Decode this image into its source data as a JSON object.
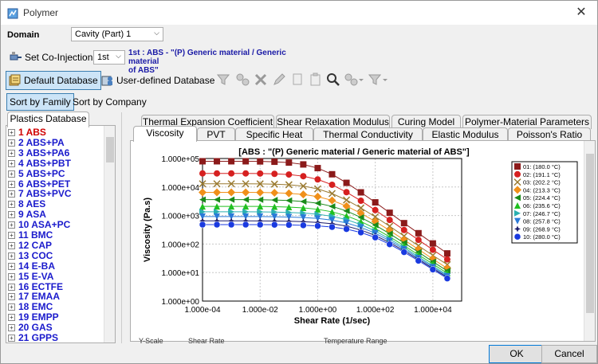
{
  "window": {
    "title": "Polymer",
    "close_label": "✕"
  },
  "domain": {
    "label": "Domain",
    "value": "Cavity (Part) 1"
  },
  "coinjection": {
    "label": "Set Co-Injection",
    "value": "1st",
    "info_line1": "1st : ABS - \"(P)  Generic material / Generic material",
    "info_line2": "of ABS\""
  },
  "toolbar": {
    "default_db": "Default Database",
    "user_db": "User-defined Database"
  },
  "sort": {
    "by_family": "Sort by Family",
    "by_company": "Sort by Company"
  },
  "left_tab": "Plastics Database",
  "materials": [
    "1  ABS",
    "2  ABS+PA",
    "3  ABS+PA6",
    "4  ABS+PBT",
    "5  ABS+PC",
    "6  ABS+PET",
    "7  ABS+PVC",
    "8  AES",
    "9  ASA",
    "10  ASA+PC",
    "11  BMC",
    "12  CAP",
    "13  COC",
    "14  E-BA",
    "15  E-VA",
    "16  ECTFE",
    "17  EMAA",
    "18  EMC",
    "19  EMPP",
    "20  GAS",
    "21  GPPS"
  ],
  "tabs_row1": [
    "Thermal Expansion Coefficient",
    "Shear Relaxation Modulus",
    "Curing Model",
    "Polymer-Material Parameters"
  ],
  "tabs_row2": [
    "Viscosity",
    "PVT",
    "Specific Heat",
    "Thermal Conductivity",
    "Elastic Modulus",
    "Poisson's Ratio"
  ],
  "bottom_partial": {
    "a": "Y-Scale",
    "b": "Shear Rate",
    "c": "Temperature Range"
  },
  "buttons": {
    "ok": "OK",
    "cancel": "Cancel"
  },
  "colors": {
    "selected_item": "#d00000",
    "item": "#1a1acc",
    "accent": "#0078d7"
  },
  "chart_data": {
    "type": "line",
    "title": "[ABS : \"(P)  Generic material / Generic material of ABS\"]",
    "xlabel": "Shear Rate (1/sec)",
    "ylabel": "Viscosity (Pa.s)",
    "x_scale": "log",
    "y_scale": "log",
    "xlim": [
      0.0001,
      100000
    ],
    "ylim": [
      1,
      100000
    ],
    "xticks": [
      "1.000e-04",
      "1.000e-02",
      "1.000e+00",
      "1.000e+02",
      "1.000e+04"
    ],
    "yticks": [
      "1.000e+00",
      "1.000e+01",
      "1.000e+02",
      "1.000e+03",
      "1.000e+04",
      "1.000e+05"
    ],
    "grid": true,
    "legend_position": "right",
    "x": [
      0.0001,
      0.000316,
      0.001,
      0.00316,
      0.01,
      0.0316,
      0.1,
      0.316,
      1,
      3.16,
      10,
      31.6,
      100,
      316,
      1000,
      3160,
      10000,
      31600
    ],
    "series": [
      {
        "name": "01: (180.0  °C)",
        "color": "#8b1a1a",
        "marker": "square",
        "values": [
          80000,
          80000,
          80000,
          80000,
          79000,
          77000,
          72000,
          62000,
          46000,
          28000,
          14000,
          6500,
          2900,
          1250,
          540,
          240,
          105,
          47
        ]
      },
      {
        "name": "02: (191.1  °C)",
        "color": "#d62020",
        "marker": "circle",
        "values": [
          30000,
          30000,
          30000,
          30000,
          29800,
          29000,
          27500,
          24000,
          18500,
          12000,
          6600,
          3300,
          1550,
          700,
          310,
          140,
          63,
          29
        ]
      },
      {
        "name": "03: (202.2  °C)",
        "color": "#9a7a30",
        "marker": "x",
        "values": [
          13000,
          13000,
          13000,
          13000,
          12900,
          12600,
          12000,
          10800,
          8600,
          5900,
          3500,
          1850,
          900,
          420,
          190,
          87,
          40,
          19
        ]
      },
      {
        "name": "04: (213.3  °C)",
        "color": "#f0901a",
        "marker": "diamond",
        "values": [
          6500,
          6500,
          6500,
          6500,
          6450,
          6300,
          6000,
          5500,
          4600,
          3400,
          2150,
          1200,
          620,
          300,
          140,
          65,
          30,
          14
        ]
      },
      {
        "name": "05: (224.4  °C)",
        "color": "#1a8a1a",
        "marker": "triangle-left",
        "values": [
          3600,
          3600,
          3600,
          3600,
          3580,
          3500,
          3350,
          3100,
          2700,
          2100,
          1450,
          860,
          460,
          230,
          110,
          52,
          24,
          11.5
        ]
      },
      {
        "name": "06: (235.6  °C)",
        "color": "#20c020",
        "marker": "triangle-up",
        "values": [
          2100,
          2100,
          2100,
          2100,
          2090,
          2050,
          1980,
          1860,
          1650,
          1350,
          980,
          620,
          350,
          180,
          88,
          42,
          20,
          9.5
        ]
      },
      {
        "name": "07: (246.7  °C)",
        "color": "#2ab0b0",
        "marker": "triangle-right",
        "values": [
          1350,
          1350,
          1350,
          1350,
          1345,
          1320,
          1280,
          1220,
          1110,
          940,
          720,
          480,
          285,
          150,
          75,
          36,
          17,
          8.2
        ]
      },
      {
        "name": "08: (257.8  °C)",
        "color": "#2a7ad8",
        "marker": "triangle-down",
        "values": [
          920,
          920,
          920,
          920,
          918,
          905,
          885,
          850,
          790,
          690,
          550,
          385,
          240,
          130,
          66,
          32,
          15.5,
          7.4
        ]
      },
      {
        "name": "09: (268.9  °C)",
        "color": "#1a1a6a",
        "marker": "star",
        "values": [
          650,
          650,
          650,
          650,
          649,
          642,
          630,
          610,
          575,
          515,
          425,
          310,
          200,
          112,
          58,
          29,
          14,
          6.8
        ]
      },
      {
        "name": "10: (280.0  °C)",
        "color": "#1a3ae0",
        "marker": "hexagon",
        "values": [
          480,
          480,
          480,
          480,
          479,
          475,
          468,
          455,
          432,
          395,
          335,
          255,
          170,
          98,
          52,
          26,
          12.8,
          6.2
        ]
      }
    ]
  }
}
